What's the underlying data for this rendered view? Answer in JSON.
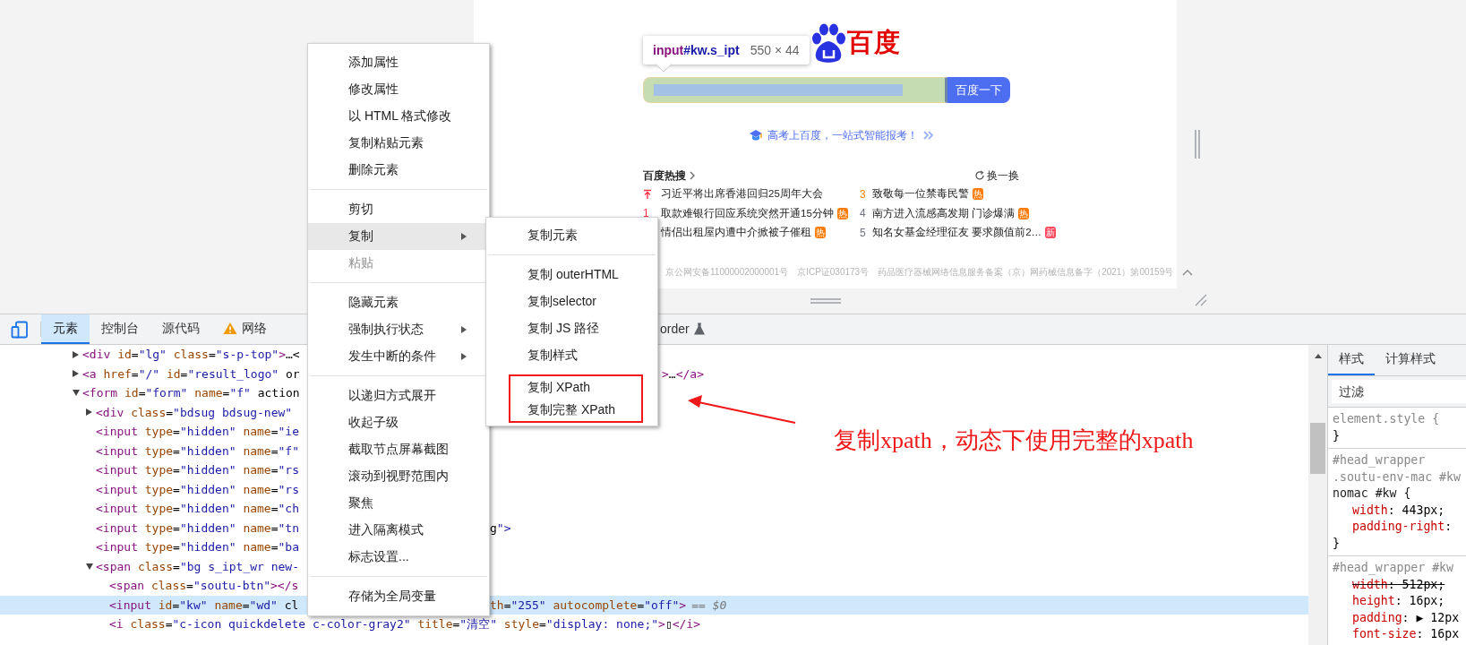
{
  "page": {
    "logo_text": "百度",
    "tooltip": {
      "element": "input",
      "selector": "#kw.s_ipt",
      "size": "550 × 44"
    },
    "search_button": "百度一下",
    "promo": "高考上百度，一站式智能报考！",
    "hot": {
      "title": "百度热搜",
      "refresh": "换一换",
      "left": [
        {
          "kind": "pinned",
          "title": "习近平将出席香港回归25周年大会"
        },
        {
          "kind": "ranked",
          "rank": "1",
          "color": "#fe2d46",
          "title": "取款难银行回应系统突然开通15分钟",
          "badge": {
            "text": "热",
            "color": "#ff7a00"
          }
        },
        {
          "kind": "plain",
          "title": "情侣出租屋内遭中介掀被子催租",
          "badge": {
            "text": "热",
            "color": "#ff7a00"
          }
        }
      ],
      "right": [
        {
          "kind": "ranked",
          "rank": "3",
          "color": "#ff8200",
          "title": "致敬每一位禁毒民警",
          "badge": {
            "text": "热",
            "color": "#ff7a00"
          }
        },
        {
          "kind": "ranked",
          "rank": "4",
          "color": "#6c7080",
          "title": "南方进入流感高发期 门诊爆满",
          "badge": {
            "text": "热",
            "color": "#ff7a00"
          }
        },
        {
          "kind": "ranked",
          "rank": "5",
          "color": "#6c7080",
          "title": "知名女基金经理征友 要求颜值前2…",
          "badge": {
            "text": "新",
            "color": "#ff455b"
          }
        }
      ]
    },
    "footer": [
      "京公网安备11000002000001号",
      "京ICP证030173号",
      "药品医疗器械网络信息服务备案（京）网药械信息备字（2021）第00159号"
    ]
  },
  "devtools": {
    "tabs": [
      {
        "kind": "plain",
        "label": "元素",
        "selected": true
      },
      {
        "kind": "plain",
        "label": "控制台",
        "selected": false
      },
      {
        "kind": "plain",
        "label": "源代码",
        "selected": false
      },
      {
        "kind": "warning",
        "label": "网络",
        "selected": false
      }
    ],
    "partial_tab": {
      "label": "order"
    },
    "elements": [
      {
        "kind": "collapsed",
        "code": "<div id=\"lg\" class=\"s-p-top\">…<",
        "selected": false
      },
      {
        "kind": "collapsed",
        "code": "<a href=\"/\" id=\"result_logo\" or",
        "tail": ">…</a>",
        "tail_past_submenu": true,
        "selected": false
      },
      {
        "kind": "expanded",
        "code": "<form id=\"form\" name=\"f\" action",
        "selected": false,
        "children": [
          {
            "kind": "collapsed",
            "code": "<div class=\"bdsug bdsug-new\"",
            "selected": false
          },
          {
            "kind": "leaf",
            "code": "<input type=\"hidden\" name=\"ie",
            "selected": false
          },
          {
            "kind": "leaf",
            "code": "<input type=\"hidden\" name=\"f\"",
            "selected": false
          },
          {
            "kind": "leaf",
            "code": "<input type=\"hidden\" name=\"rs",
            "selected": false
          },
          {
            "kind": "leaf",
            "code": "<input type=\"hidden\" name=\"rs",
            "selected": false
          },
          {
            "kind": "leaf",
            "code": "<input type=\"hidden\" name=\"ch",
            "selected": false
          },
          {
            "kind": "leaf",
            "code": "<input type=\"hidden\" name=\"tn",
            "tail": "g\">",
            "tail_past_submenu": false,
            "selected": false
          },
          {
            "kind": "leaf",
            "code": "<input type=\"hidden\" name=\"ba",
            "selected": false
          },
          {
            "kind": "expanded",
            "code": "<span class=\"bg s_ipt_wr new-",
            "selected": false,
            "children": [
              {
                "kind": "leaf",
                "code": "<span class=\"soutu-btn\"></s",
                "selected": false
              },
              {
                "kind": "leaf",
                "code": "<input id=\"kw\" name=\"wd\" cl",
                "tail": "th=\"255\" autocomplete=\"off\">",
                "marker": "== $0",
                "tail_past_submenu": false,
                "selected": true
              },
              {
                "kind": "leaf",
                "code": "<i class=\"c-icon quickdelete c-color-gray2\" title=\"清空\" style=\"display: none;\">▯</i>",
                "selected": false
              }
            ]
          }
        ]
      }
    ],
    "styles": {
      "tabs": [
        {
          "label": "样式",
          "selected": true
        },
        {
          "label": "计算样式",
          "selected": false
        }
      ],
      "filter_placeholder": "过滤",
      "rules": [
        {
          "selector": [
            "element.style {"
          ],
          "close": "}"
        },
        {
          "selector": [
            "#head_wrapper",
            ".soutu-env-mac #kw",
            "nomac #kw {"
          ],
          "declarations": [
            {
              "text": "width: 443px;",
              "struck": false
            },
            {
              "text": "padding-right:",
              "struck": false
            }
          ],
          "close": "}"
        },
        {
          "selector": [
            "#head_wrapper #kw"
          ],
          "declarations": [
            {
              "text": "width: 512px;",
              "struck": true
            },
            {
              "text": "height: 16px;",
              "struck": false
            },
            {
              "text": "padding: ▶ 12px",
              "struck": false
            },
            {
              "text": "font-size: 16px",
              "struck": false
            }
          ]
        }
      ]
    }
  },
  "context_menu": {
    "items": [
      {
        "kind": "item",
        "label": "添加属性",
        "selected": false,
        "disabled": false,
        "has_submenu": false
      },
      {
        "kind": "item",
        "label": "修改属性",
        "selected": false,
        "disabled": false,
        "has_submenu": false
      },
      {
        "kind": "item",
        "label": "以 HTML 格式修改",
        "selected": false,
        "disabled": false,
        "has_submenu": false
      },
      {
        "kind": "item",
        "label": "复制粘贴元素",
        "selected": false,
        "disabled": false,
        "has_submenu": false
      },
      {
        "kind": "item",
        "label": "删除元素",
        "selected": false,
        "disabled": false,
        "has_submenu": false
      },
      {
        "kind": "separator"
      },
      {
        "kind": "item",
        "label": "剪切",
        "selected": false,
        "disabled": false,
        "has_submenu": false
      },
      {
        "kind": "item",
        "label": "复制",
        "selected": true,
        "disabled": false,
        "has_submenu": true,
        "submenu": [
          {
            "kind": "item",
            "label": "复制元素",
            "boxed": false
          },
          {
            "kind": "separator"
          },
          {
            "kind": "item",
            "label": "复制 outerHTML",
            "boxed": false
          },
          {
            "kind": "item",
            "label": "复制selector",
            "boxed": false
          },
          {
            "kind": "item",
            "label": "复制 JS 路径",
            "boxed": false
          },
          {
            "kind": "item",
            "label": "复制样式",
            "boxed": false
          },
          {
            "kind": "item",
            "label": "复制 XPath",
            "boxed": true
          },
          {
            "kind": "item",
            "label": "复制完整 XPath",
            "boxed": true
          }
        ]
      },
      {
        "kind": "item",
        "label": "粘贴",
        "selected": false,
        "disabled": true,
        "has_submenu": false
      },
      {
        "kind": "separator"
      },
      {
        "kind": "item",
        "label": "隐藏元素",
        "selected": false,
        "disabled": false,
        "has_submenu": false
      },
      {
        "kind": "item",
        "label": "强制执行状态",
        "selected": false,
        "disabled": false,
        "has_submenu": true
      },
      {
        "kind": "item",
        "label": "发生中断的条件",
        "selected": false,
        "disabled": false,
        "has_submenu": true
      },
      {
        "kind": "separator"
      },
      {
        "kind": "item",
        "label": "以递归方式展开",
        "selected": false,
        "disabled": false,
        "has_submenu": false
      },
      {
        "kind": "item",
        "label": "收起子级",
        "selected": false,
        "disabled": false,
        "has_submenu": false
      },
      {
        "kind": "item",
        "label": "截取节点屏幕截图",
        "selected": false,
        "disabled": false,
        "has_submenu": false
      },
      {
        "kind": "item",
        "label": "滚动到视野范围内",
        "selected": false,
        "disabled": false,
        "has_submenu": false
      },
      {
        "kind": "item",
        "label": "聚焦",
        "selected": false,
        "disabled": false,
        "has_submenu": false
      },
      {
        "kind": "item",
        "label": "进入隔离模式",
        "selected": false,
        "disabled": false,
        "has_submenu": false
      },
      {
        "kind": "item",
        "label": "标志设置...",
        "selected": false,
        "disabled": false,
        "has_submenu": false
      },
      {
        "kind": "separator"
      },
      {
        "kind": "item",
        "label": "存储为全局变量",
        "selected": false,
        "disabled": false,
        "has_submenu": false
      }
    ]
  },
  "annotation": {
    "text": "复制xpath，动态下使用完整的xpath"
  }
}
